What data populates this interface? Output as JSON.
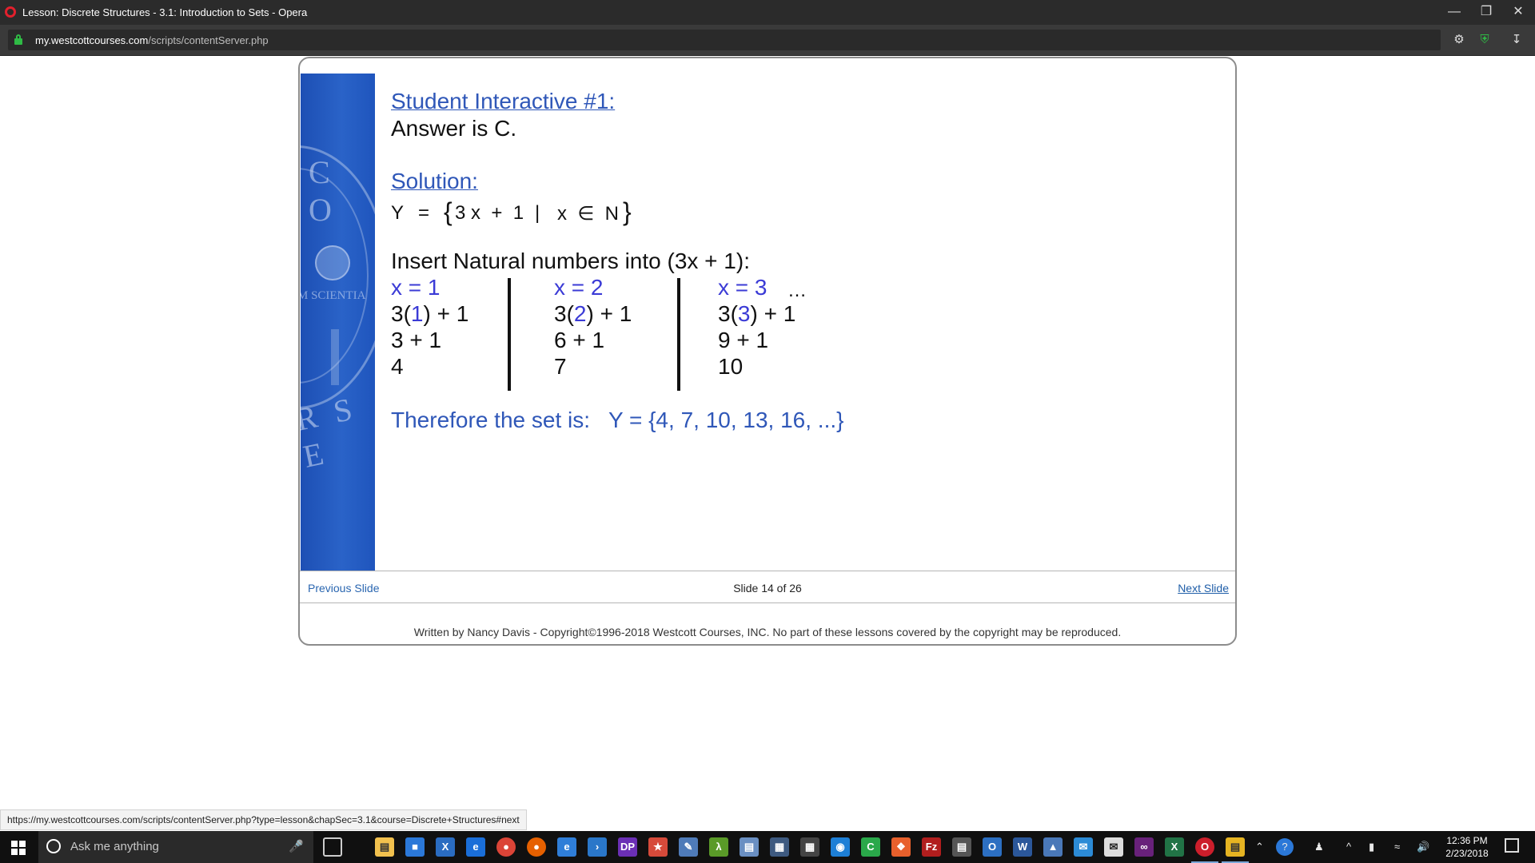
{
  "window": {
    "title": "Lesson: Discrete Structures - 3.1: Introduction to Sets - Opera"
  },
  "addressbar": {
    "url_host": "my.westcottcourses.com",
    "url_path": "/scripts/contentServer.php"
  },
  "slide": {
    "heading1": "Student Interactive #1:",
    "answer": "Answer is C.",
    "heading2": "Solution:",
    "set_def": {
      "lhs": "Y",
      "eq": "=",
      "lbrace": "{",
      "expr": "3 x  +  1",
      "bar": "|",
      "cond": "x  ∈  N",
      "rbrace": "}"
    },
    "instruction": "Insert Natural numbers into (3x + 1):",
    "columns": [
      {
        "header": "x = 1",
        "line1_pre": "3(",
        "line1_num": "1",
        "line1_post": ") + 1",
        "line2": "3 + 1",
        "line3": "4"
      },
      {
        "header": "x = 2",
        "line1_pre": "3(",
        "line1_num": "2",
        "line1_post": ") + 1",
        "line2": "6 + 1",
        "line3": "7"
      },
      {
        "header": "x = 3",
        "line1_pre": "3(",
        "line1_num": "3",
        "line1_post": ") + 1",
        "line2": "9 + 1",
        "line3": "10"
      }
    ],
    "ellipsis": "…",
    "conclusion_label": "Therefore the set is:",
    "conclusion_set": "Y = {4, 7, 10, 13, 16, ...}",
    "sidebar_seal_text": {
      "top": "C O",
      "mid": "M SCIENTIA",
      "bottom": "R S E"
    }
  },
  "nav": {
    "prev": "Previous Slide",
    "count": "Slide 14 of 26",
    "next": "Next Slide"
  },
  "footer": {
    "copyright": "Written by Nancy Davis - Copyright©1996-2018 Westcott Courses, INC. No part of these lessons covered by the copyright may be reproduced."
  },
  "status_url": "https://my.westcottcourses.com/scripts/contentServer.php?type=lesson&chapSec=3.1&course=Discrete+Structures#next",
  "taskbar": {
    "search_placeholder": "Ask me anything",
    "time": "12:36 PM",
    "date": "2/23/2018"
  },
  "colors": {
    "heading_blue": "#2f57b8",
    "number_blue": "#3b3bd6",
    "sidebar_blue": "#2a63c8"
  }
}
